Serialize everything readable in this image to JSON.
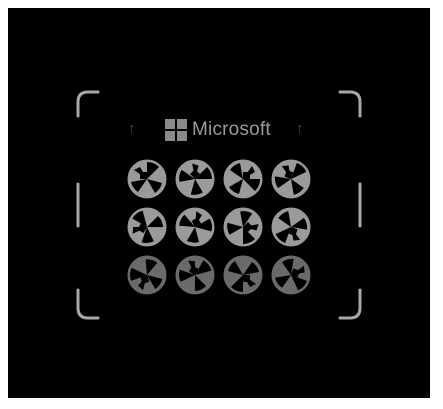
{
  "brand": {
    "name": "Microsoft",
    "logo_icon": "microsoft-logo-icon",
    "left_arrow_icon": "up-arrow-icon",
    "right_arrow_icon": "up-arrow-icon",
    "left_arrow_glyph": "↑",
    "right_arrow_glyph": "↑"
  },
  "viewfinder": {
    "icon": "camera-viewfinder-corners",
    "frame_color": "#b0b0b0"
  },
  "match_grid": {
    "rows": 3,
    "cols": 4,
    "tile_icon": "rotated-pattern-tile-icon",
    "brightness_by_row": [
      "#9a9a9a",
      "#9a9a9a",
      "#6a6a6a"
    ]
  },
  "colors": {
    "background": "#000000",
    "outer_border": "#ffffff"
  }
}
